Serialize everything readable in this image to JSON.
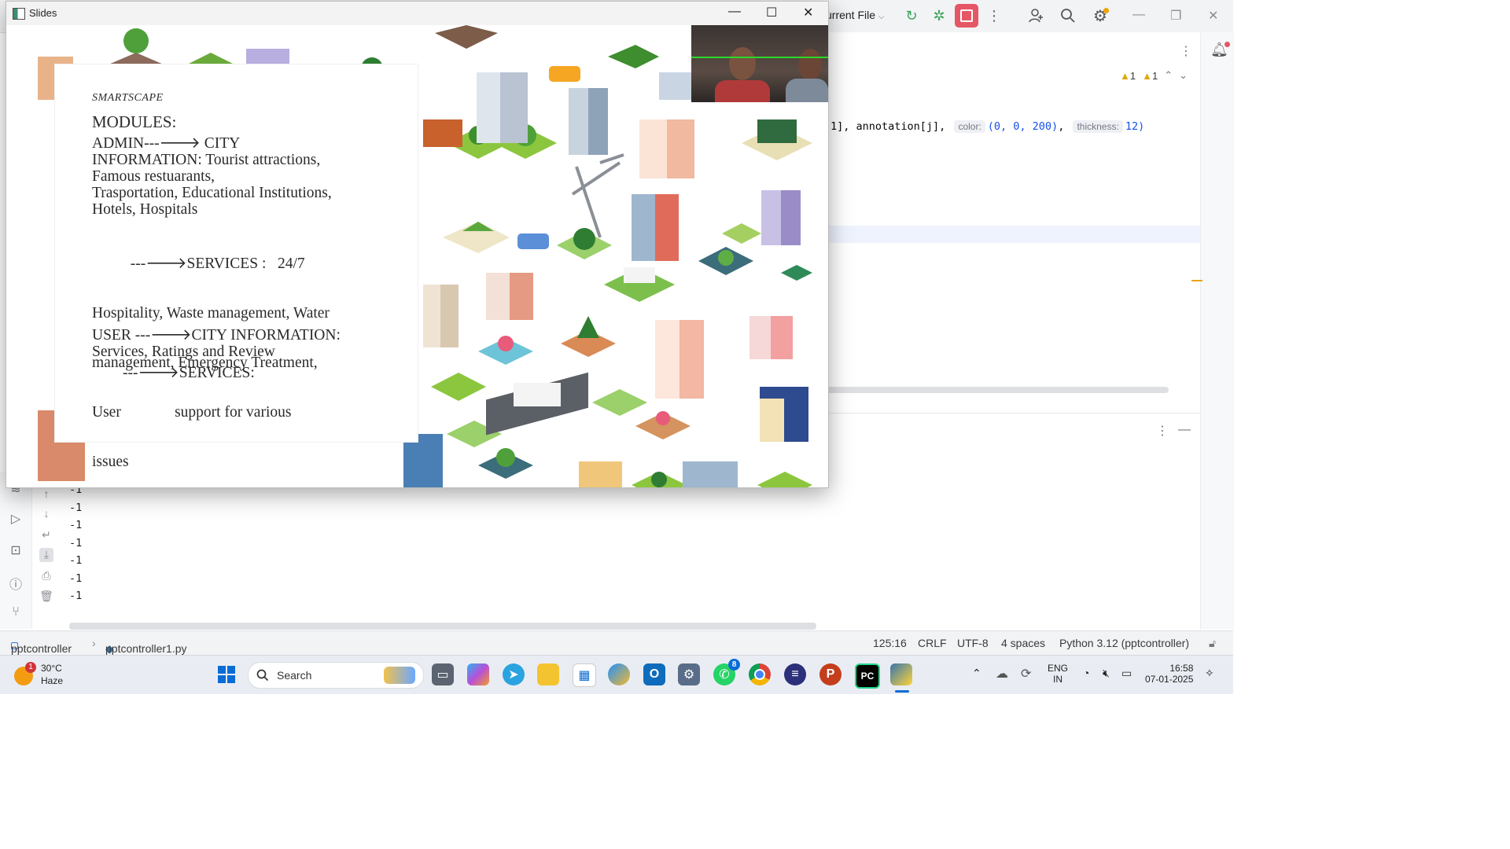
{
  "ide": {
    "run_config": "urrent File",
    "code_line": {
      "prefix": "1], annotation[j], ",
      "hint_color": "color:",
      "tuple": "(0, 0, 200)",
      "hint_thickness": "thickness:",
      "value": "12)"
    },
    "warnings": {
      "a": "1",
      "b": "1"
    },
    "console_lines": [
      "-1",
      "-1",
      "-1",
      "-1",
      "-1",
      "-1",
      "-1"
    ]
  },
  "status": {
    "project": "pptcontroller",
    "file": "pptcontroller1.py",
    "position": "125:16",
    "line_sep": "CRLF",
    "encoding": "UTF-8",
    "indent": "4 spaces",
    "interpreter": "Python 3.12 (pptcontroller)"
  },
  "slides_window": {
    "title": "Slides",
    "slide": {
      "brand": "SMARTSCAPE",
      "heading": "MODULES:",
      "admin_lines": [
        "ADMIN---🡒 CITY",
        "INFORMATION: Tourist attractions,",
        "Famous restuarants,",
        "Trasportation, Educational Institutions,",
        "Hotels, Hospitals"
      ],
      "services_lines": [
        "          ---🡒SERVICES :   24/7",
        "Hospitality, Waste management, Water",
        "management, Emergency Treatment,",
        "User              support for various",
        "issues"
      ],
      "user_lines": [
        "USER ---🡒CITY INFORMATION:",
        "Services, Ratings and Review"
      ],
      "user_services": "        ---🡒SERVICES:"
    }
  },
  "taskbar": {
    "weather_temp": "30°C",
    "weather_desc": "Haze",
    "weather_badge": "1",
    "search_placeholder": "Search",
    "whatsapp_badge": "8",
    "lang_top": "ENG",
    "lang_bottom": "IN",
    "time": "16:58",
    "date": "07-01-2025"
  },
  "colors": {
    "stop_button": "#e55765",
    "slide_text": "#2a2a2a",
    "tracking_line": "#2bd82b",
    "pycharm_badge": "#21d789"
  }
}
